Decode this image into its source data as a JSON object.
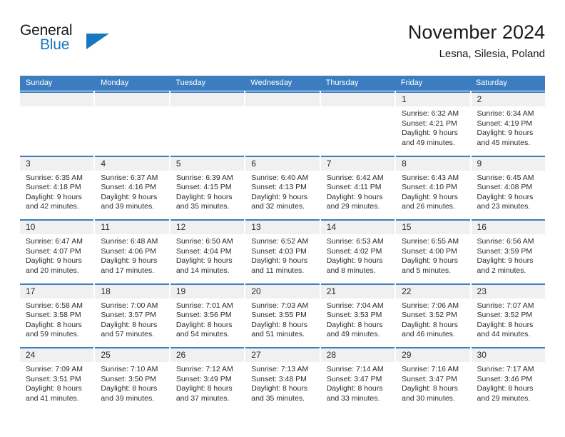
{
  "brand": {
    "name_part1": "General",
    "name_part2": "Blue",
    "triangle_color": "#1878bf",
    "accent_color": "#3b7dc0"
  },
  "header": {
    "title": "November 2024",
    "subtitle": "Lesna, Silesia, Poland"
  },
  "weekday_headers": [
    "Sunday",
    "Monday",
    "Tuesday",
    "Wednesday",
    "Thursday",
    "Friday",
    "Saturday"
  ],
  "weeks": [
    {
      "days": [
        {
          "blank": true
        },
        {
          "blank": true
        },
        {
          "blank": true
        },
        {
          "blank": true
        },
        {
          "blank": true
        },
        {
          "blank": false,
          "date": "1",
          "sunrise": "Sunrise: 6:32 AM",
          "sunset": "Sunset: 4:21 PM",
          "daylight_line1": "Daylight: 9 hours",
          "daylight_line2": "and 49 minutes."
        },
        {
          "blank": false,
          "date": "2",
          "sunrise": "Sunrise: 6:34 AM",
          "sunset": "Sunset: 4:19 PM",
          "daylight_line1": "Daylight: 9 hours",
          "daylight_line2": "and 45 minutes."
        }
      ]
    },
    {
      "days": [
        {
          "blank": false,
          "date": "3",
          "sunrise": "Sunrise: 6:35 AM",
          "sunset": "Sunset: 4:18 PM",
          "daylight_line1": "Daylight: 9 hours",
          "daylight_line2": "and 42 minutes."
        },
        {
          "blank": false,
          "date": "4",
          "sunrise": "Sunrise: 6:37 AM",
          "sunset": "Sunset: 4:16 PM",
          "daylight_line1": "Daylight: 9 hours",
          "daylight_line2": "and 39 minutes."
        },
        {
          "blank": false,
          "date": "5",
          "sunrise": "Sunrise: 6:39 AM",
          "sunset": "Sunset: 4:15 PM",
          "daylight_line1": "Daylight: 9 hours",
          "daylight_line2": "and 35 minutes."
        },
        {
          "blank": false,
          "date": "6",
          "sunrise": "Sunrise: 6:40 AM",
          "sunset": "Sunset: 4:13 PM",
          "daylight_line1": "Daylight: 9 hours",
          "daylight_line2": "and 32 minutes."
        },
        {
          "blank": false,
          "date": "7",
          "sunrise": "Sunrise: 6:42 AM",
          "sunset": "Sunset: 4:11 PM",
          "daylight_line1": "Daylight: 9 hours",
          "daylight_line2": "and 29 minutes."
        },
        {
          "blank": false,
          "date": "8",
          "sunrise": "Sunrise: 6:43 AM",
          "sunset": "Sunset: 4:10 PM",
          "daylight_line1": "Daylight: 9 hours",
          "daylight_line2": "and 26 minutes."
        },
        {
          "blank": false,
          "date": "9",
          "sunrise": "Sunrise: 6:45 AM",
          "sunset": "Sunset: 4:08 PM",
          "daylight_line1": "Daylight: 9 hours",
          "daylight_line2": "and 23 minutes."
        }
      ]
    },
    {
      "days": [
        {
          "blank": false,
          "date": "10",
          "sunrise": "Sunrise: 6:47 AM",
          "sunset": "Sunset: 4:07 PM",
          "daylight_line1": "Daylight: 9 hours",
          "daylight_line2": "and 20 minutes."
        },
        {
          "blank": false,
          "date": "11",
          "sunrise": "Sunrise: 6:48 AM",
          "sunset": "Sunset: 4:06 PM",
          "daylight_line1": "Daylight: 9 hours",
          "daylight_line2": "and 17 minutes."
        },
        {
          "blank": false,
          "date": "12",
          "sunrise": "Sunrise: 6:50 AM",
          "sunset": "Sunset: 4:04 PM",
          "daylight_line1": "Daylight: 9 hours",
          "daylight_line2": "and 14 minutes."
        },
        {
          "blank": false,
          "date": "13",
          "sunrise": "Sunrise: 6:52 AM",
          "sunset": "Sunset: 4:03 PM",
          "daylight_line1": "Daylight: 9 hours",
          "daylight_line2": "and 11 minutes."
        },
        {
          "blank": false,
          "date": "14",
          "sunrise": "Sunrise: 6:53 AM",
          "sunset": "Sunset: 4:02 PM",
          "daylight_line1": "Daylight: 9 hours",
          "daylight_line2": "and 8 minutes."
        },
        {
          "blank": false,
          "date": "15",
          "sunrise": "Sunrise: 6:55 AM",
          "sunset": "Sunset: 4:00 PM",
          "daylight_line1": "Daylight: 9 hours",
          "daylight_line2": "and 5 minutes."
        },
        {
          "blank": false,
          "date": "16",
          "sunrise": "Sunrise: 6:56 AM",
          "sunset": "Sunset: 3:59 PM",
          "daylight_line1": "Daylight: 9 hours",
          "daylight_line2": "and 2 minutes."
        }
      ]
    },
    {
      "days": [
        {
          "blank": false,
          "date": "17",
          "sunrise": "Sunrise: 6:58 AM",
          "sunset": "Sunset: 3:58 PM",
          "daylight_line1": "Daylight: 8 hours",
          "daylight_line2": "and 59 minutes."
        },
        {
          "blank": false,
          "date": "18",
          "sunrise": "Sunrise: 7:00 AM",
          "sunset": "Sunset: 3:57 PM",
          "daylight_line1": "Daylight: 8 hours",
          "daylight_line2": "and 57 minutes."
        },
        {
          "blank": false,
          "date": "19",
          "sunrise": "Sunrise: 7:01 AM",
          "sunset": "Sunset: 3:56 PM",
          "daylight_line1": "Daylight: 8 hours",
          "daylight_line2": "and 54 minutes."
        },
        {
          "blank": false,
          "date": "20",
          "sunrise": "Sunrise: 7:03 AM",
          "sunset": "Sunset: 3:55 PM",
          "daylight_line1": "Daylight: 8 hours",
          "daylight_line2": "and 51 minutes."
        },
        {
          "blank": false,
          "date": "21",
          "sunrise": "Sunrise: 7:04 AM",
          "sunset": "Sunset: 3:53 PM",
          "daylight_line1": "Daylight: 8 hours",
          "daylight_line2": "and 49 minutes."
        },
        {
          "blank": false,
          "date": "22",
          "sunrise": "Sunrise: 7:06 AM",
          "sunset": "Sunset: 3:52 PM",
          "daylight_line1": "Daylight: 8 hours",
          "daylight_line2": "and 46 minutes."
        },
        {
          "blank": false,
          "date": "23",
          "sunrise": "Sunrise: 7:07 AM",
          "sunset": "Sunset: 3:52 PM",
          "daylight_line1": "Daylight: 8 hours",
          "daylight_line2": "and 44 minutes."
        }
      ]
    },
    {
      "days": [
        {
          "blank": false,
          "date": "24",
          "sunrise": "Sunrise: 7:09 AM",
          "sunset": "Sunset: 3:51 PM",
          "daylight_line1": "Daylight: 8 hours",
          "daylight_line2": "and 41 minutes."
        },
        {
          "blank": false,
          "date": "25",
          "sunrise": "Sunrise: 7:10 AM",
          "sunset": "Sunset: 3:50 PM",
          "daylight_line1": "Daylight: 8 hours",
          "daylight_line2": "and 39 minutes."
        },
        {
          "blank": false,
          "date": "26",
          "sunrise": "Sunrise: 7:12 AM",
          "sunset": "Sunset: 3:49 PM",
          "daylight_line1": "Daylight: 8 hours",
          "daylight_line2": "and 37 minutes."
        },
        {
          "blank": false,
          "date": "27",
          "sunrise": "Sunrise: 7:13 AM",
          "sunset": "Sunset: 3:48 PM",
          "daylight_line1": "Daylight: 8 hours",
          "daylight_line2": "and 35 minutes."
        },
        {
          "blank": false,
          "date": "28",
          "sunrise": "Sunrise: 7:14 AM",
          "sunset": "Sunset: 3:47 PM",
          "daylight_line1": "Daylight: 8 hours",
          "daylight_line2": "and 33 minutes."
        },
        {
          "blank": false,
          "date": "29",
          "sunrise": "Sunrise: 7:16 AM",
          "sunset": "Sunset: 3:47 PM",
          "daylight_line1": "Daylight: 8 hours",
          "daylight_line2": "and 30 minutes."
        },
        {
          "blank": false,
          "date": "30",
          "sunrise": "Sunrise: 7:17 AM",
          "sunset": "Sunset: 3:46 PM",
          "daylight_line1": "Daylight: 8 hours",
          "daylight_line2": "and 29 minutes."
        }
      ]
    }
  ]
}
